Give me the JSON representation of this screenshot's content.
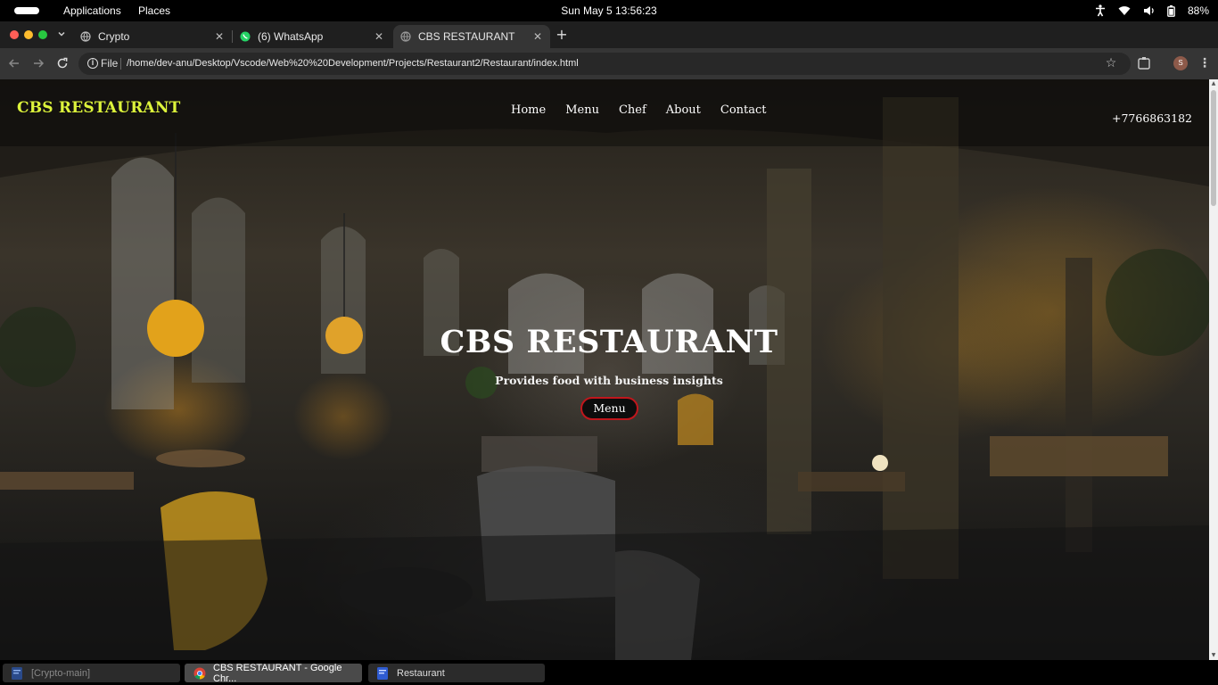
{
  "system_bar": {
    "applications": "Applications",
    "places": "Places",
    "datetime": "Sun May 5  13:56:23",
    "battery": "88%",
    "icons": [
      "accessibility-icon",
      "wifi-icon",
      "volume-icon",
      "battery-icon"
    ]
  },
  "browser": {
    "tabs": [
      {
        "title": "Crypto",
        "icon": "globe-icon"
      },
      {
        "title": "(6) WhatsApp",
        "icon": "whatsapp-icon"
      },
      {
        "title": "CBS RESTAURANT",
        "icon": "globe-icon",
        "active": true
      }
    ],
    "address": {
      "scheme_label": "File",
      "url": "/home/dev-anu/Desktop/Vscode/Web%20%20Development/Projects/Restaurant2/Restaurant/index.html"
    },
    "profile_initial": "S"
  },
  "site": {
    "brand": "CBS RESTAURANT",
    "nav": [
      "Home",
      "Menu",
      "Chef",
      "About",
      "Contact"
    ],
    "phone": "+7766863182",
    "hero": {
      "title": "CBS RESTAURANT",
      "subtitle": "Provides food with business insights",
      "button": "Menu"
    },
    "colors": {
      "brand": "#ddf43b",
      "button_border": "#c0161c"
    }
  },
  "taskbar": {
    "items": [
      {
        "label": "[Crypto-main]"
      },
      {
        "label": "CBS RESTAURANT - Google Chr..."
      },
      {
        "label": "Restaurant"
      }
    ]
  }
}
